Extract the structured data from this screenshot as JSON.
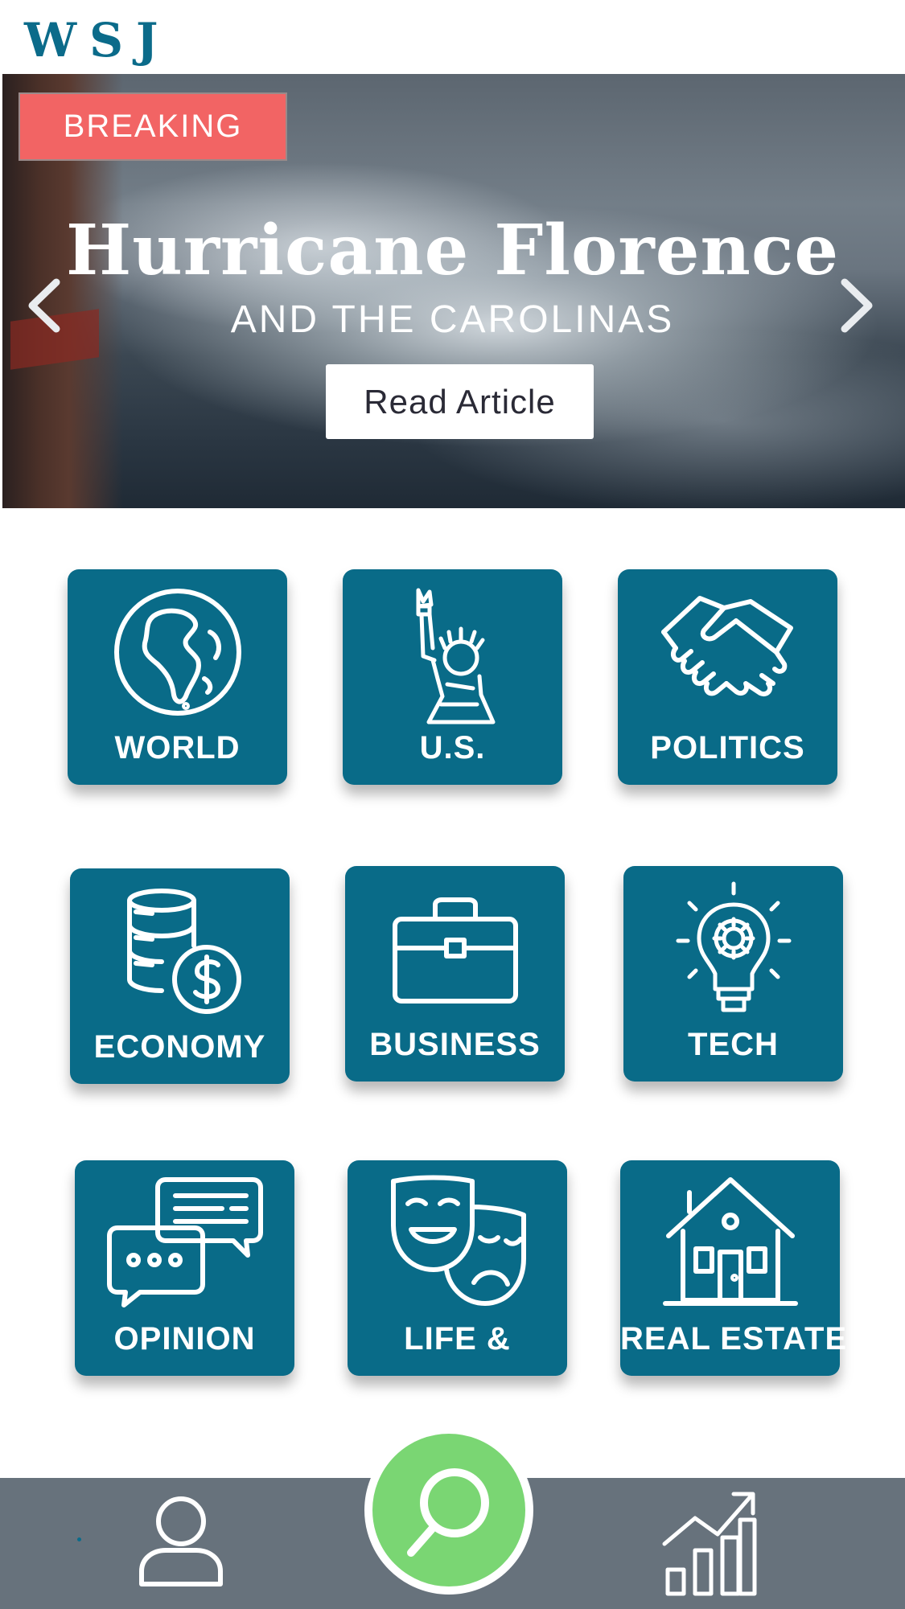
{
  "header": {
    "logo": "WSJ"
  },
  "hero": {
    "badge": "BREAKING",
    "title": "Hurricane Florence",
    "subtitle": "AND THE CAROLINAS",
    "cta": "Read Article",
    "prev_icon": "chevron-left-icon",
    "next_icon": "chevron-right-icon"
  },
  "categories": [
    {
      "label": "WORLD",
      "icon": "globe-icon"
    },
    {
      "label": "U.S.",
      "icon": "statue-of-liberty-icon"
    },
    {
      "label": "POLITICS",
      "icon": "handshake-icon"
    },
    {
      "label": "ECONOMY",
      "icon": "coins-dollar-icon"
    },
    {
      "label": "BUSINESS",
      "icon": "briefcase-icon"
    },
    {
      "label": "TECH",
      "icon": "lightbulb-gear-icon"
    },
    {
      "label": "OPINION",
      "icon": "chat-bubbles-icon"
    },
    {
      "label": "LIFE &",
      "icon": "theater-masks-icon"
    },
    {
      "label": "REAL ESTATE",
      "icon": "house-icon"
    }
  ],
  "bottom_nav": {
    "items": [
      "profile-icon",
      "search-icon",
      "growth-chart-icon"
    ]
  },
  "colors": {
    "brand": "#0b6b8a",
    "tile": "#096b88",
    "breaking": "#f26464",
    "search_button": "#7ad673",
    "nav_bar": "#67727c"
  }
}
